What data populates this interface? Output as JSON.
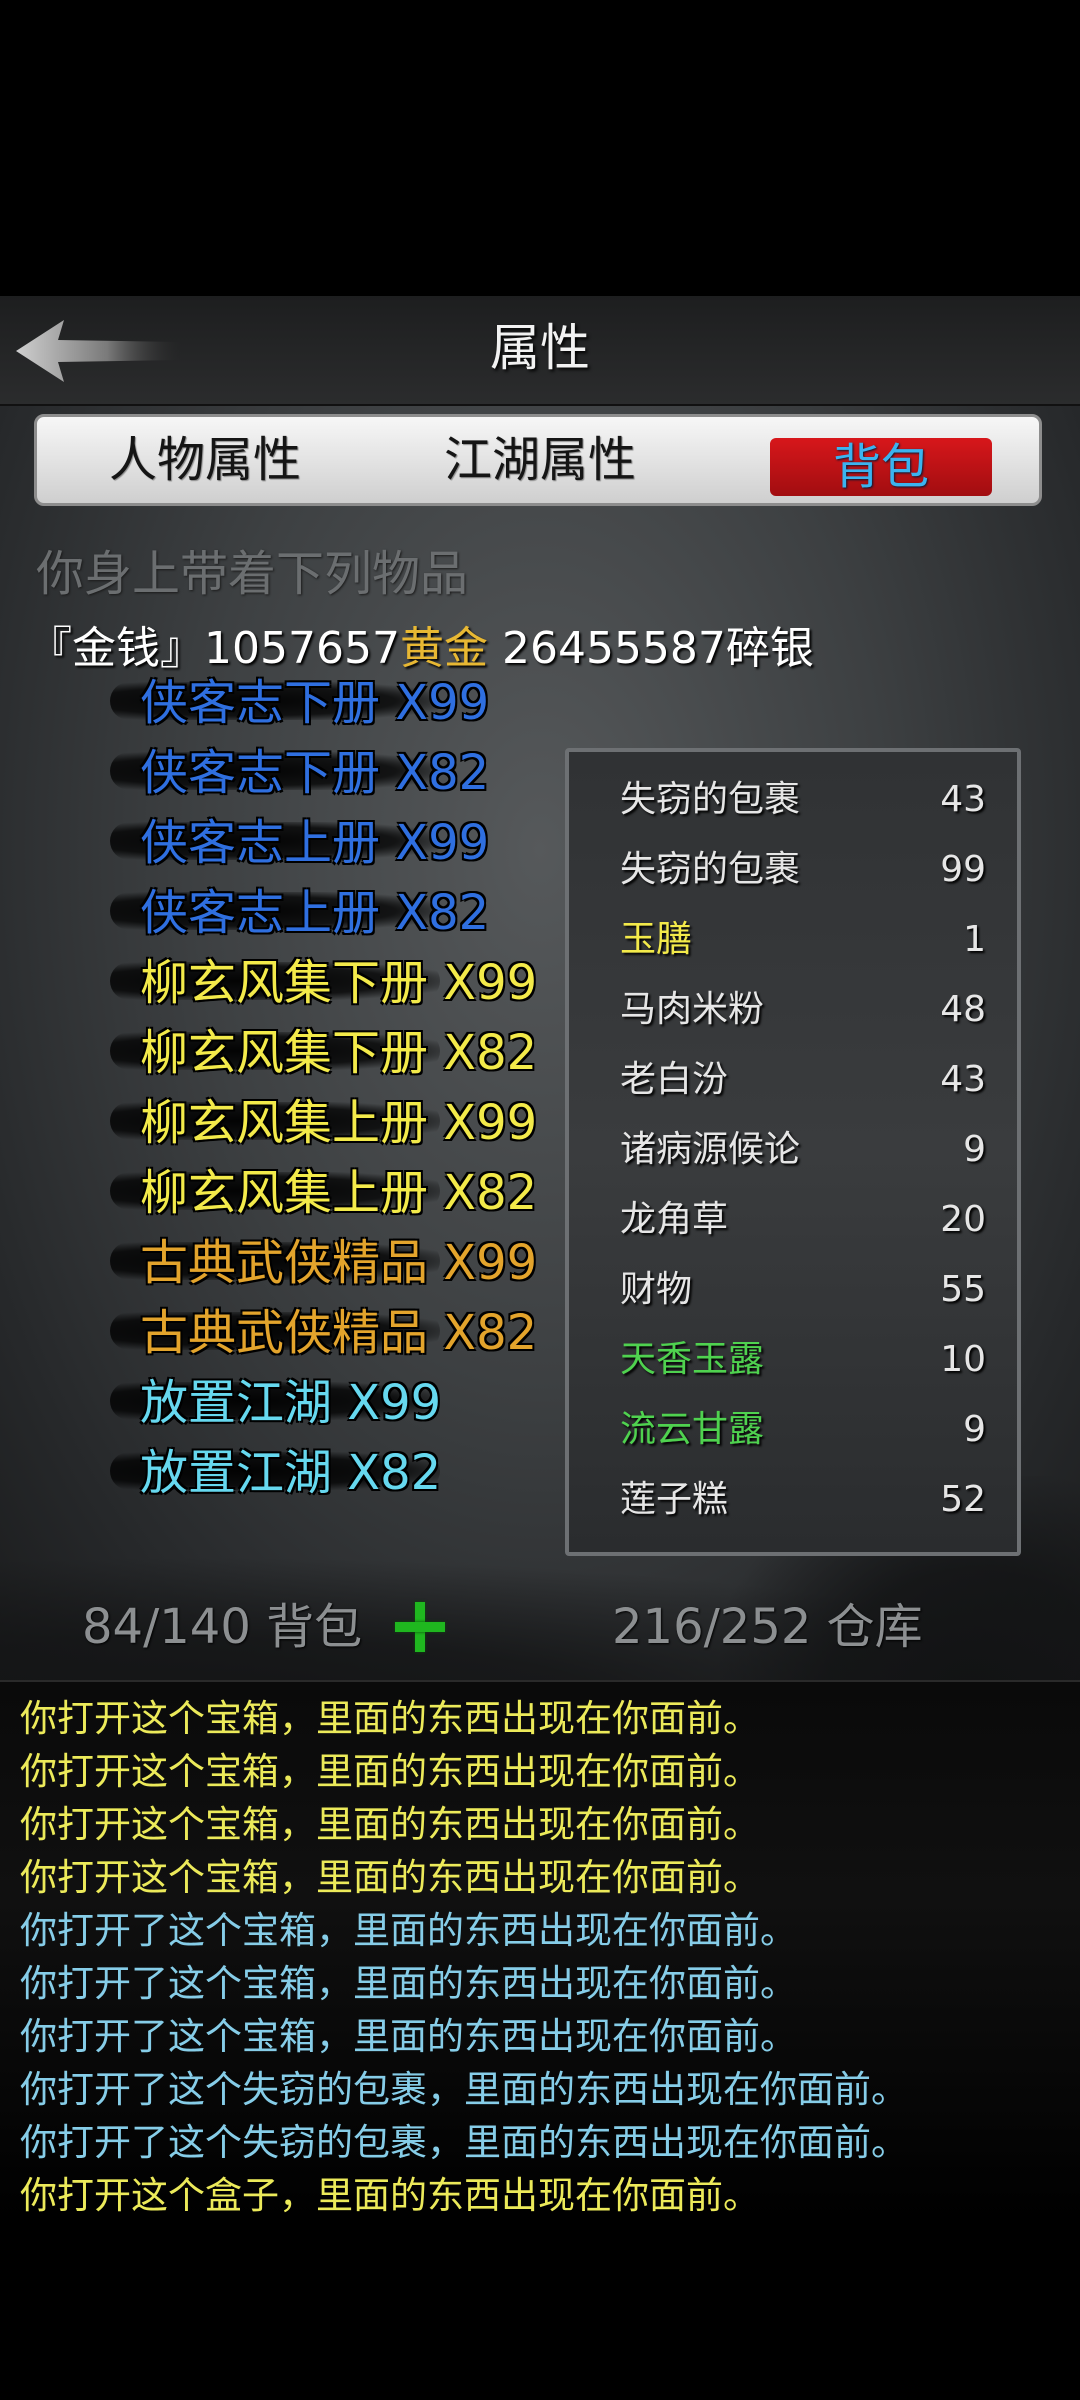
{
  "header": {
    "title": "属性",
    "back_icon": "back-arrow-icon"
  },
  "tabs": [
    {
      "label": "人物属性",
      "active": false
    },
    {
      "label": "江湖属性",
      "active": false
    },
    {
      "label": "背包",
      "active": true
    }
  ],
  "carry_label": "你身上带着下列物品",
  "money": {
    "prefix": "『金钱』",
    "gold_amount": "1057657",
    "gold_label": "黄金",
    "silver_amount": " 26455587",
    "silver_label": "碎银"
  },
  "colors": {
    "blue_item": "#2f6fe0",
    "yellow_item": "#f3ea4a",
    "gold_item": "#e3a42c",
    "cyan_item": "#66d8ef",
    "green_item": "#4fd24f",
    "yellow_log": "#ecea5a",
    "cyan_log": "#86cde8",
    "tab_active_bg": "#c4161a"
  },
  "left_items": [
    {
      "text": "侠客志下册 X99",
      "color": "blue"
    },
    {
      "text": "侠客志下册 X82",
      "color": "blue"
    },
    {
      "text": "侠客志上册 X99",
      "color": "blue"
    },
    {
      "text": "侠客志上册 X82",
      "color": "blue"
    },
    {
      "text": "柳玄风集下册 X99",
      "color": "yellow"
    },
    {
      "text": "柳玄风集下册 X82",
      "color": "yellow"
    },
    {
      "text": "柳玄风集上册 X99",
      "color": "yellow"
    },
    {
      "text": "柳玄风集上册 X82",
      "color": "yellow"
    },
    {
      "text": "古典武侠精品 X99",
      "color": "gold"
    },
    {
      "text": "古典武侠精品 X82",
      "color": "gold"
    },
    {
      "text": "放置江湖 X99",
      "color": "cyan"
    },
    {
      "text": "放置江湖 X82",
      "color": "cyan"
    }
  ],
  "right_items": [
    {
      "name": "失窃的包裹",
      "count": "43",
      "color": "white"
    },
    {
      "name": "失窃的包裹",
      "count": "99",
      "color": "white"
    },
    {
      "name": "玉膳",
      "count": "1",
      "color": "yellow"
    },
    {
      "name": "马肉米粉",
      "count": "48",
      "color": "white"
    },
    {
      "name": "老白汾",
      "count": "43",
      "color": "white"
    },
    {
      "name": "诸病源候论",
      "count": "9",
      "color": "white"
    },
    {
      "name": "龙角草",
      "count": "20",
      "color": "white"
    },
    {
      "name": "财物",
      "count": "55",
      "color": "white"
    },
    {
      "name": "天香玉露",
      "count": "10",
      "color": "green"
    },
    {
      "name": "流云甘露",
      "count": "9",
      "color": "green"
    },
    {
      "name": "莲子糕",
      "count": "52",
      "color": "white"
    }
  ],
  "capacity": {
    "bag": "84/140 背包",
    "store": "216/252 仓库",
    "add_icon": "plus-icon"
  },
  "log": [
    {
      "text": "你打开这个宝箱，里面的东西出现在你面前。",
      "color": "yellow"
    },
    {
      "text": "你打开这个宝箱，里面的东西出现在你面前。",
      "color": "yellow"
    },
    {
      "text": "你打开这个宝箱，里面的东西出现在你面前。",
      "color": "yellow"
    },
    {
      "text": "你打开这个宝箱，里面的东西出现在你面前。",
      "color": "yellow"
    },
    {
      "text": "你打开了这个宝箱，里面的东西出现在你面前。",
      "color": "cyan"
    },
    {
      "text": "你打开了这个宝箱，里面的东西出现在你面前。",
      "color": "cyan"
    },
    {
      "text": "你打开了这个宝箱，里面的东西出现在你面前。",
      "color": "cyan"
    },
    {
      "text": "你打开了这个失窃的包裹，里面的东西出现在你面前。",
      "color": "cyan"
    },
    {
      "text": "你打开了这个失窃的包裹，里面的东西出现在你面前。",
      "color": "cyan"
    },
    {
      "text": "你打开这个盒子，里面的东西出现在你面前。",
      "color": "yellow"
    }
  ]
}
